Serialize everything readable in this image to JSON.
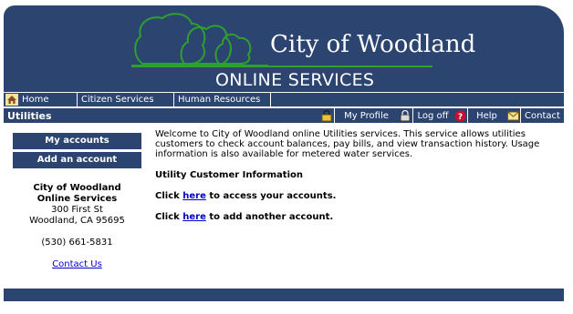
{
  "banner": {
    "title": "City of Woodland",
    "subtitle": "ONLINE SERVICES",
    "colors": {
      "bar": "#2b4470",
      "logo_green": "#2ea02e"
    }
  },
  "nav": {
    "items": [
      {
        "label": "Home",
        "icon": "home-icon"
      },
      {
        "label": "Citizen Services"
      },
      {
        "label": "Human Resources"
      }
    ]
  },
  "toolbar": {
    "section_title": "Utilities",
    "links": [
      {
        "icon": "lock-icon"
      },
      {
        "label": "My Profile"
      },
      {
        "icon": "lock-icon"
      },
      {
        "label": "Log off"
      },
      {
        "icon": "help-icon"
      },
      {
        "label": "Help"
      },
      {
        "icon": "mail-icon"
      },
      {
        "label": "Contact"
      }
    ]
  },
  "sidebar": {
    "buttons": [
      {
        "label": "My accounts"
      },
      {
        "label": "Add an account"
      }
    ],
    "org_name_line1": "City of Woodland",
    "org_name_line2": "Online Services",
    "street": "300 First St",
    "city": "Woodland, CA 95695",
    "phone": "(530) 661-5831",
    "contact_link": "Contact Us"
  },
  "main": {
    "intro": "Welcome to City of Woodland online Utilities services. This service allows utilities customers to check account balances, pay bills, and view transaction history. Usage information is also available for metered water services.",
    "heading": "Utility Customer Information",
    "line1_pre": "Click ",
    "line1_link": "here",
    "line1_post": " to access your accounts.",
    "line2_pre": "Click ",
    "line2_link": "here",
    "line2_post": " to add another account."
  }
}
